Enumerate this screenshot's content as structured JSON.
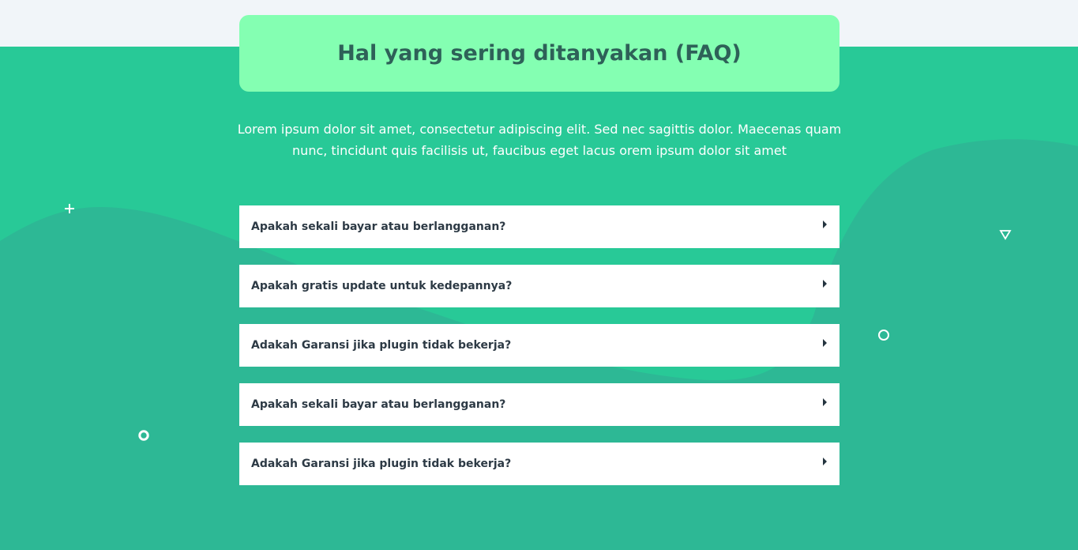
{
  "faq": {
    "title": "Hal yang sering ditanyakan (FAQ)",
    "intro": "Lorem ipsum dolor sit amet, consectetur adipiscing elit. Sed nec sagittis dolor. Maecenas quam nunc, tincidunt quis facilisis ut, faucibus eget lacus orem ipsum dolor sit amet",
    "items": [
      {
        "question": "Apakah sekali bayar atau berlangganan?",
        "icon": "caret-right-icon"
      },
      {
        "question": "Apakah gratis update untuk kedepannya?",
        "icon": "caret-right-icon"
      },
      {
        "question": "Adakah Garansi jika plugin tidak bekerja?",
        "icon": "caret-right-icon"
      },
      {
        "question": "Apakah sekali bayar atau berlangganan?",
        "icon": "caret-right-icon"
      },
      {
        "question": "Adakah Garansi jika plugin tidak bekerja?",
        "icon": "caret-right-icon"
      }
    ]
  },
  "decorations": [
    "plus-icon",
    "triangle-outline-icon",
    "circle-outline-icon",
    "ring-icon"
  ],
  "colors": {
    "background": "#28c997",
    "wave": "#2db895",
    "title_box": "#84ffb2",
    "title_text": "#2e6158",
    "top_strip": "#f1f5f9",
    "card": "#ffffff",
    "question_text": "#2d3a45"
  }
}
